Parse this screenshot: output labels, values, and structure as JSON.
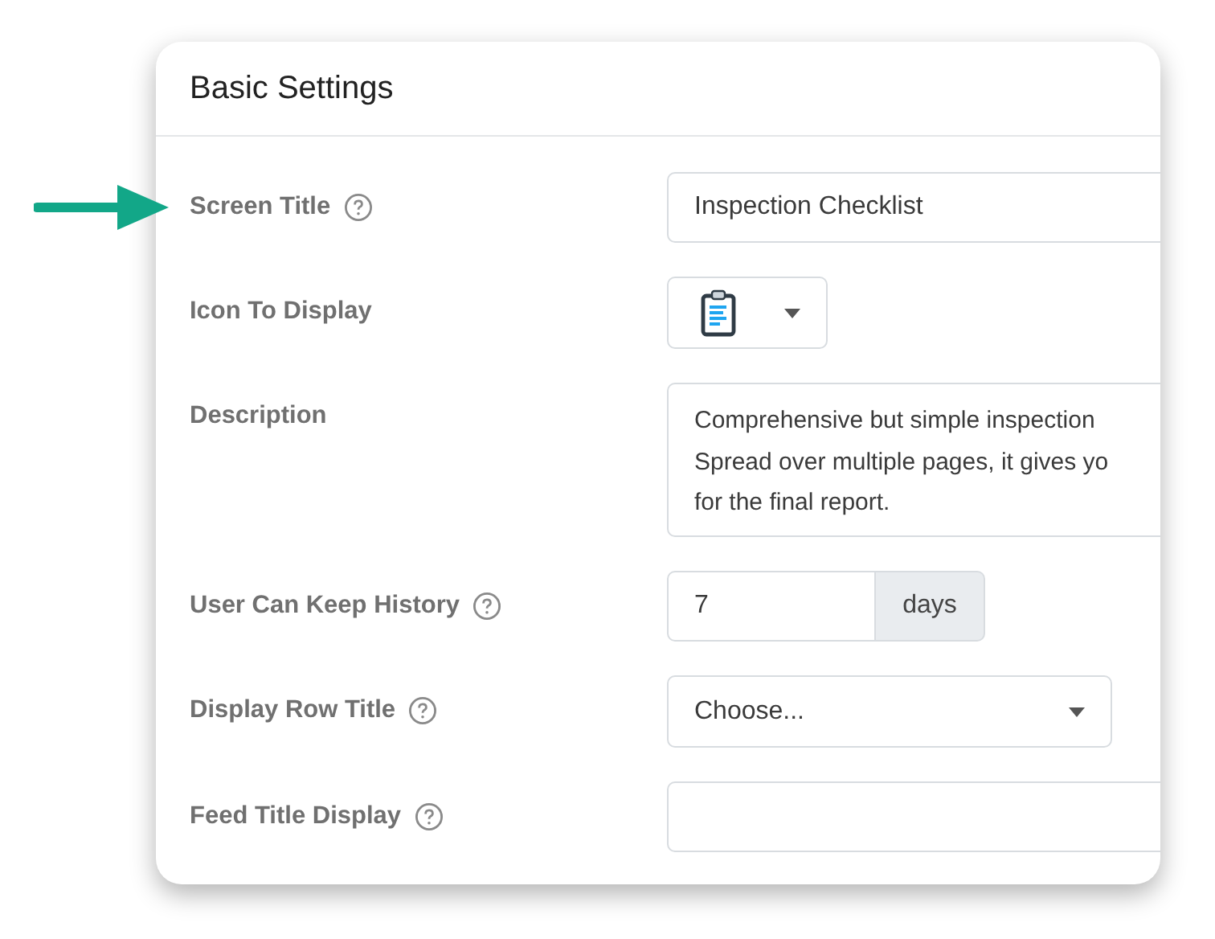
{
  "panel": {
    "title": "Basic Settings"
  },
  "fields": [
    {
      "kind": "text",
      "label": "Screen Title",
      "help": true,
      "highlighted": true,
      "value": "Inspection Checklist"
    },
    {
      "kind": "icon-select",
      "label": "Icon To Display",
      "help": false,
      "highlighted": false
    },
    {
      "kind": "textarea",
      "label": "Description",
      "help": false,
      "highlighted": false,
      "value": "Comprehensive but simple inspection\nSpread over multiple pages, it gives yo\nfor the final report."
    },
    {
      "kind": "number-addon",
      "label": "User Can Keep History",
      "help": true,
      "highlighted": false,
      "value": "7",
      "addon": "days"
    },
    {
      "kind": "select",
      "label": "Display Row Title",
      "help": true,
      "highlighted": false,
      "value": "Choose..."
    },
    {
      "kind": "text",
      "label": "Feed Title Display",
      "help": true,
      "highlighted": false
    }
  ]
}
